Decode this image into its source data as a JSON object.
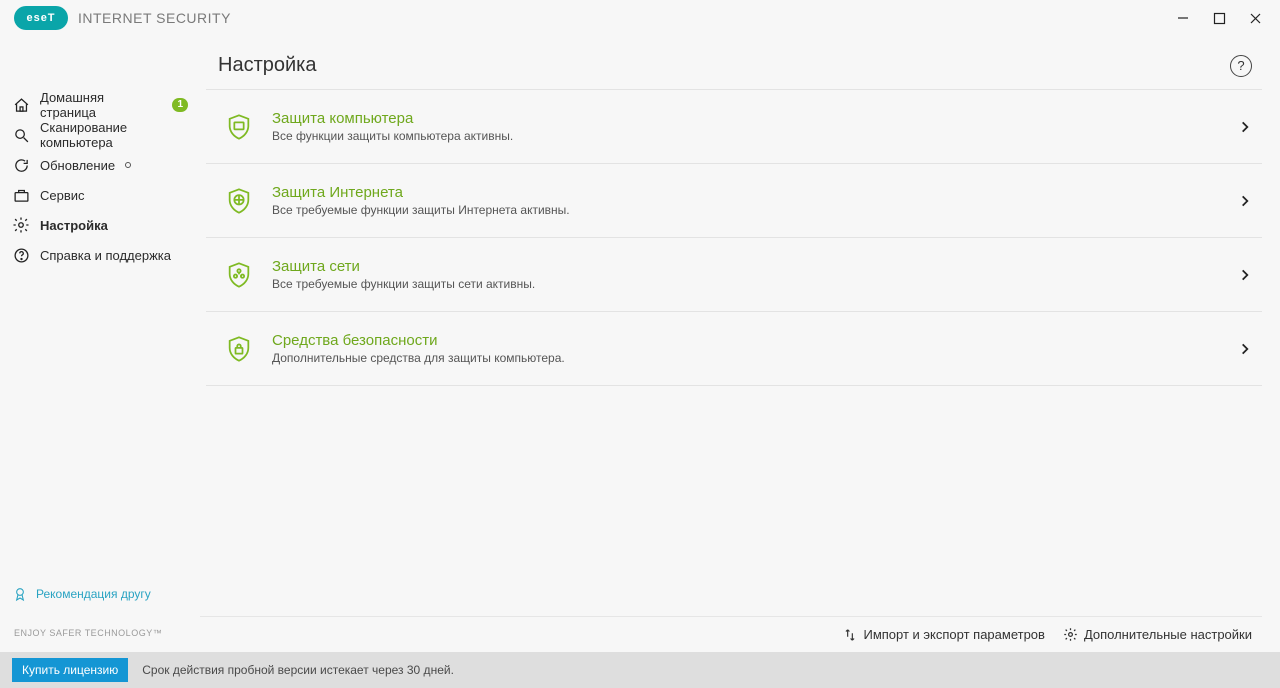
{
  "brand": {
    "logo_text": "eseT",
    "product": "INTERNET SECURITY"
  },
  "sidebar": {
    "items": [
      {
        "label": "Домашняя страница",
        "badge": "1",
        "icon": "home"
      },
      {
        "label": "Сканирование компьютера",
        "icon": "search"
      },
      {
        "label": "Обновление",
        "dot": true,
        "icon": "refresh"
      },
      {
        "label": "Сервис",
        "icon": "briefcase"
      },
      {
        "label": "Настройка",
        "icon": "gear",
        "active": true
      },
      {
        "label": "Справка и поддержка",
        "icon": "help"
      }
    ],
    "refer": "Рекомендация другу",
    "slogan": "ENJOY SAFER TECHNOLOGY™"
  },
  "page": {
    "title": "Настройка"
  },
  "cards": [
    {
      "title": "Защита компьютера",
      "desc": "Все функции защиты компьютера активны."
    },
    {
      "title": "Защита Интернета",
      "desc": "Все требуемые функции защиты Интернета активны."
    },
    {
      "title": "Защита сети",
      "desc": "Все требуемые функции защиты сети активны."
    },
    {
      "title": "Средства безопасности",
      "desc": "Дополнительные средства для защиты компьютера."
    }
  ],
  "footer": {
    "import_export": "Импорт и экспорт параметров",
    "advanced": "Дополнительные настройки"
  },
  "statusbar": {
    "buy": "Купить лицензию",
    "trial": "Срок действия пробной версии истекает через 30 дней."
  }
}
